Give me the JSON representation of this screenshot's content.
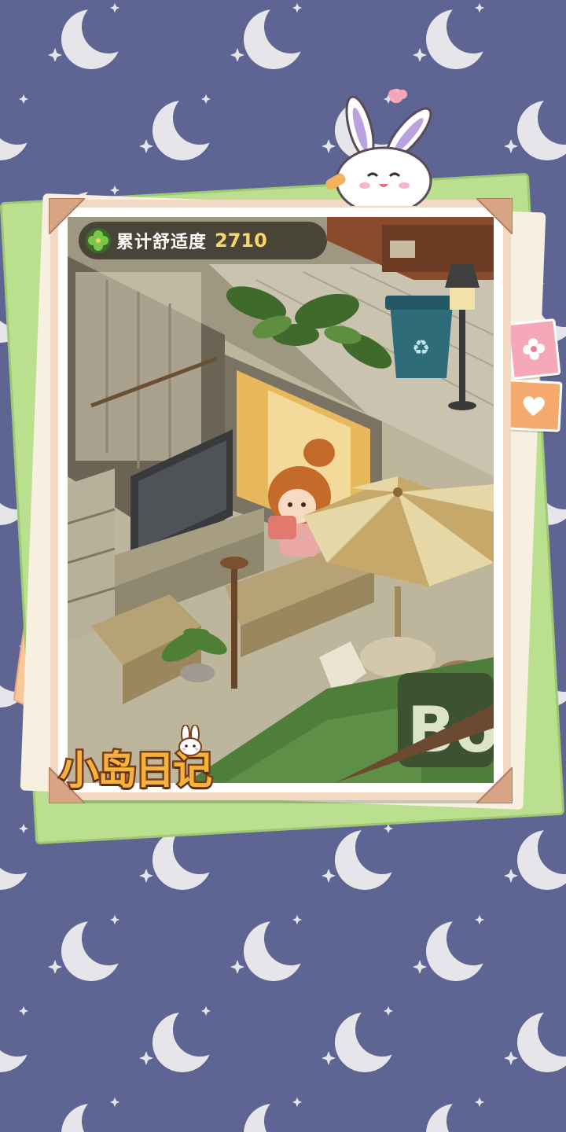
{
  "hud": {
    "comfort_label": "累计舒适度",
    "comfort_value": "2710",
    "icon": "clover-icon"
  },
  "logo": {
    "text": "小岛日记",
    "icon": "bunny-icon"
  },
  "scene": {
    "sign_text": "Bo",
    "icons": [
      "recycle-bin-icon",
      "street-lamp-icon",
      "tv-icon",
      "umbrella-icon",
      "character"
    ]
  },
  "decor": {
    "stickers": [
      "flower-sticker-icon",
      "heart-sticker-icon"
    ],
    "background_pattern": "moon-star-pattern"
  },
  "colors": {
    "background": "#5f6592",
    "frame": "#f3d9c3",
    "accent_value": "#f7d66a",
    "logo_fill": "#f6b33a",
    "logo_stroke": "#7a3f1f"
  }
}
